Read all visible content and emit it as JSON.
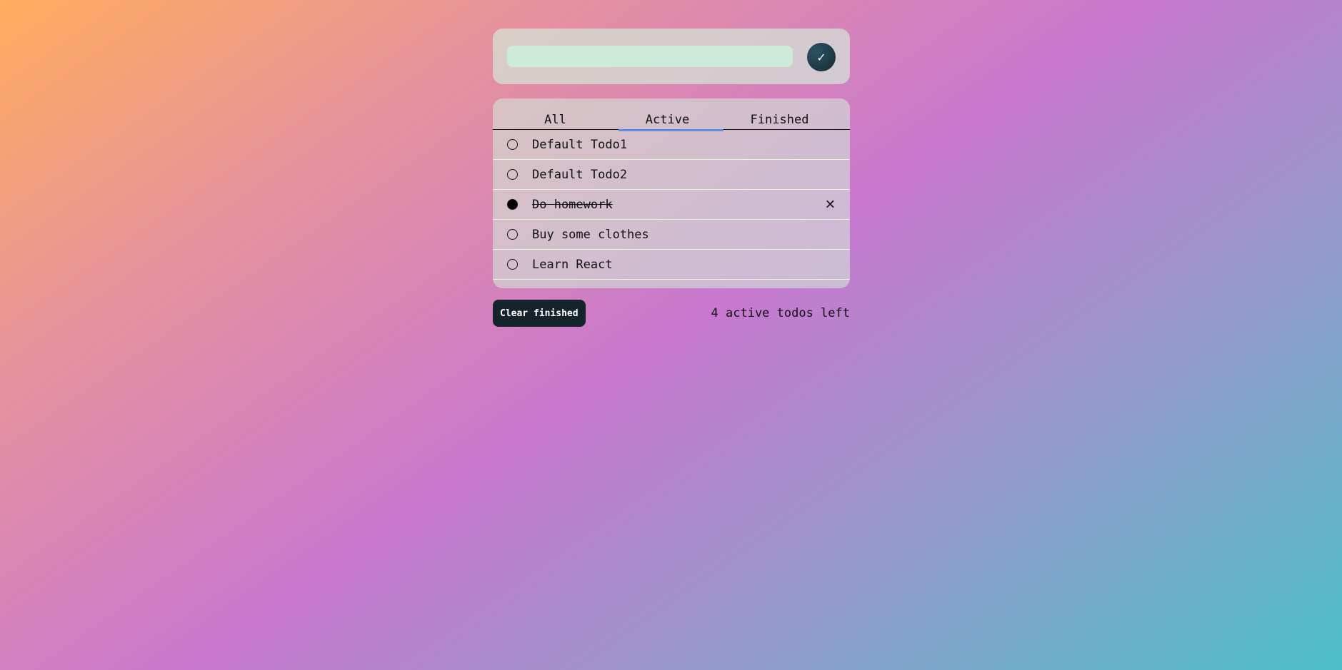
{
  "input": {
    "value": "",
    "placeholder": "",
    "submit_icon": "✓"
  },
  "tabs": [
    {
      "label": "All"
    },
    {
      "label": "Active"
    },
    {
      "label": "Finished"
    }
  ],
  "active_tab": "Active",
  "todos": [
    {
      "text": "Default Todo1",
      "done": false
    },
    {
      "text": "Default Todo2",
      "done": false
    },
    {
      "text": "Do homework",
      "done": true,
      "delete_icon": "✕"
    },
    {
      "text": "Buy some clothes",
      "done": false
    },
    {
      "text": "Learn React",
      "done": false
    }
  ],
  "footer": {
    "clear_label": "Clear finished",
    "count_text": "4 active todos left"
  },
  "colors": {
    "tab_underline": "#5b8fe3",
    "button_dark": "#15242b"
  }
}
